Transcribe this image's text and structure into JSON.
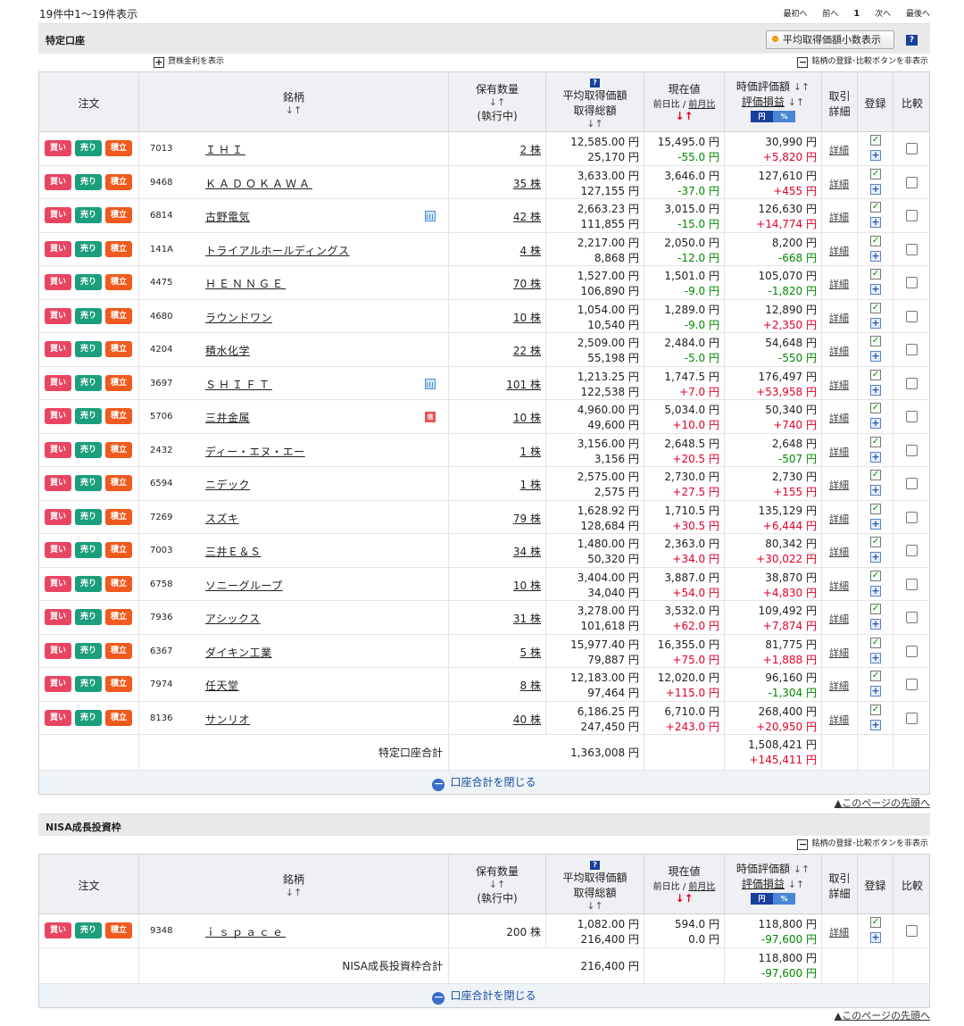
{
  "pagination": {
    "count_text": "19件中1～19件表示",
    "first": "最初へ",
    "prev": "前へ",
    "current": "1",
    "next": "次へ",
    "last": "最後へ"
  },
  "labels": {
    "order": "注文",
    "name": "銘柄",
    "qty": "保有数量",
    "exec": "(執行中)",
    "avg": "平均取得価額",
    "total_cost": "取得総額",
    "current": "現在値",
    "day_change": "前日比",
    "day_change_pct": "前月比",
    "market_value": "時価評価額",
    "gain": "評価損益",
    "detail": "取引",
    "detail2": "詳細",
    "register": "登録",
    "compare": "比較",
    "buy": "買い",
    "sell": "売り",
    "accum": "積立",
    "detail_link": "詳細",
    "yen": "円",
    "pct": "%",
    "sort_arrow": "↓↑",
    "red_arrow": "↓↑",
    "help": "?",
    "close_total": "口座合計を閉じる",
    "page_top": "▲このページの先頭へ",
    "slash": "/"
  },
  "section1": {
    "title": "特定口座",
    "decimal_toggle": "平均取得価額小数表示",
    "lending_toggle": "貸株金利を表示",
    "hide_buttons": "銘柄の登録･比較ボタンを非表示",
    "sum_label": "特定口座合計",
    "sum_cost": "1,363,008 円",
    "sum_value": "1,508,421 円",
    "sum_gain": "+145,411 円",
    "rows": [
      {
        "code": "7013",
        "name": "ＩＨＩ",
        "sp": true,
        "badge": "",
        "qty": "2 株",
        "avg": "12,585.00 円",
        "cost": "25,170 円",
        "price": "15,495.0 円",
        "chg": "-55.0 円",
        "val": "30,990 円",
        "gain": "+5,820 円"
      },
      {
        "code": "9468",
        "name": "ＫＡＤＯＫＡＷＡ",
        "sp": true,
        "badge": "",
        "qty": "35 株",
        "avg": "3,633.00 円",
        "cost": "127,155 円",
        "price": "3,646.0 円",
        "chg": "-37.0 円",
        "val": "127,610 円",
        "gain": "+455 円"
      },
      {
        "code": "6814",
        "name": "古野電気",
        "sp": false,
        "badge": "cal",
        "qty": "42 株",
        "avg": "2,663.23 円",
        "cost": "111,855 円",
        "price": "3,015.0 円",
        "chg": "-15.0 円",
        "val": "126,630 円",
        "gain": "+14,774 円"
      },
      {
        "code": "141A",
        "name": "トライアルホールディングス",
        "sp": false,
        "badge": "",
        "qty": "4 株",
        "avg": "2,217.00 円",
        "cost": "8,868 円",
        "price": "2,050.0 円",
        "chg": "-12.0 円",
        "val": "8,200 円",
        "gain": "-668 円"
      },
      {
        "code": "4475",
        "name": "ＨＥＮＮＧＥ",
        "sp": true,
        "badge": "",
        "qty": "70 株",
        "avg": "1,527.00 円",
        "cost": "106,890 円",
        "price": "1,501.0 円",
        "chg": "-9.0 円",
        "val": "105,070 円",
        "gain": "-1,820 円"
      },
      {
        "code": "4680",
        "name": "ラウンドワン",
        "sp": false,
        "badge": "",
        "qty": "10 株",
        "avg": "1,054.00 円",
        "cost": "10,540 円",
        "price": "1,289.0 円",
        "chg": "-9.0 円",
        "val": "12,890 円",
        "gain": "+2,350 円"
      },
      {
        "code": "4204",
        "name": "積水化学",
        "sp": false,
        "badge": "",
        "qty": "22 株",
        "avg": "2,509.00 円",
        "cost": "55,198 円",
        "price": "2,484.0 円",
        "chg": "-5.0 円",
        "val": "54,648 円",
        "gain": "-550 円"
      },
      {
        "code": "3697",
        "name": "ＳＨＩＦＴ",
        "sp": true,
        "badge": "cal",
        "qty": "101 株",
        "avg": "1,213.25 円",
        "cost": "122,538 円",
        "price": "1,747.5 円",
        "chg": "+7.0 円",
        "val": "176,497 円",
        "gain": "+53,958 円"
      },
      {
        "code": "5706",
        "name": "三井金属",
        "sp": false,
        "badge": "cr",
        "qty": "10 株",
        "avg": "4,960.00 円",
        "cost": "49,600 円",
        "price": "5,034.0 円",
        "chg": "+10.0 円",
        "val": "50,340 円",
        "gain": "+740 円"
      },
      {
        "code": "2432",
        "name": "ディー・エヌ・エー",
        "sp": false,
        "badge": "",
        "qty": "1 株",
        "avg": "3,156.00 円",
        "cost": "3,156 円",
        "price": "2,648.5 円",
        "chg": "+20.5 円",
        "val": "2,648 円",
        "gain": "-507 円"
      },
      {
        "code": "6594",
        "name": "ニデック",
        "sp": false,
        "badge": "",
        "qty": "1 株",
        "avg": "2,575.00 円",
        "cost": "2,575 円",
        "price": "2,730.0 円",
        "chg": "+27.5 円",
        "val": "2,730 円",
        "gain": "+155 円"
      },
      {
        "code": "7269",
        "name": "スズキ",
        "sp": false,
        "badge": "",
        "qty": "79 株",
        "avg": "1,628.92 円",
        "cost": "128,684 円",
        "price": "1,710.5 円",
        "chg": "+30.5 円",
        "val": "135,129 円",
        "gain": "+6,444 円"
      },
      {
        "code": "7003",
        "name": "三井Ｅ＆Ｓ",
        "sp": false,
        "badge": "",
        "qty": "34 株",
        "avg": "1,480.00 円",
        "cost": "50,320 円",
        "price": "2,363.0 円",
        "chg": "+34.0 円",
        "val": "80,342 円",
        "gain": "+30,022 円"
      },
      {
        "code": "6758",
        "name": "ソニーグループ",
        "sp": false,
        "badge": "",
        "qty": "10 株",
        "avg": "3,404.00 円",
        "cost": "34,040 円",
        "price": "3,887.0 円",
        "chg": "+54.0 円",
        "val": "38,870 円",
        "gain": "+4,830 円"
      },
      {
        "code": "7936",
        "name": "アシックス",
        "sp": false,
        "badge": "",
        "qty": "31 株",
        "avg": "3,278.00 円",
        "cost": "101,618 円",
        "price": "3,532.0 円",
        "chg": "+62.0 円",
        "val": "109,492 円",
        "gain": "+7,874 円"
      },
      {
        "code": "6367",
        "name": "ダイキン工業",
        "sp": false,
        "badge": "",
        "qty": "5 株",
        "avg": "15,977.40 円",
        "cost": "79,887 円",
        "price": "16,355.0 円",
        "chg": "+75.0 円",
        "val": "81,775 円",
        "gain": "+1,888 円"
      },
      {
        "code": "7974",
        "name": "任天堂",
        "sp": false,
        "badge": "",
        "qty": "8 株",
        "avg": "12,183.00 円",
        "cost": "97,464 円",
        "price": "12,020.0 円",
        "chg": "+115.0 円",
        "val": "96,160 円",
        "gain": "-1,304 円"
      },
      {
        "code": "8136",
        "name": "サンリオ",
        "sp": false,
        "badge": "",
        "qty": "40 株",
        "avg": "6,186.25 円",
        "cost": "247,450 円",
        "price": "6,710.0 円",
        "chg": "+243.0 円",
        "val": "268,400 円",
        "gain": "+20,950 円"
      }
    ]
  },
  "section2": {
    "title": "NISA成長投資枠",
    "hide_buttons": "銘柄の登録･比較ボタンを非表示",
    "sum_label": "NISA成長投資枠合計",
    "sum_cost": "216,400 円",
    "sum_value": "118,800 円",
    "sum_gain": "-97,600 円",
    "rows": [
      {
        "code": "9348",
        "name": "ｉｓｐａｃｅ",
        "sp": true,
        "badge": "",
        "qty": "200 株",
        "avg": "1,082.00 円",
        "cost": "216,400 円",
        "price": "594.0 円",
        "chg": "0.0 円",
        "val": "118,800 円",
        "gain": "-97,600 円"
      }
    ]
  },
  "colors": {
    "buy": "#e84563",
    "sell": "#1b9e7b",
    "accum": "#f05a1e",
    "positive": "#e0002a",
    "negative": "#008a00",
    "header_bg": "#eef0f3"
  }
}
